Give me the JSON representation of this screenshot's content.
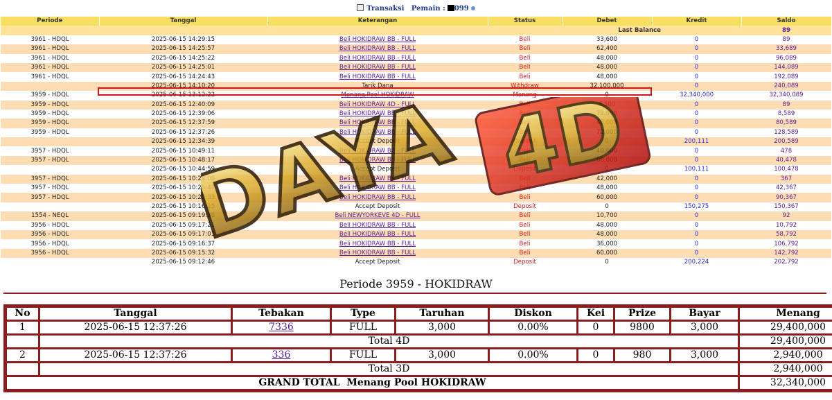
{
  "header": {
    "label": "Transaksi",
    "pemain_label": "Pemain :",
    "pemain_suffix": "099"
  },
  "transactions": {
    "columns": [
      "Periode",
      "Tanggal",
      "Keterangan",
      "Status",
      "Debet",
      "Kredit",
      "Saldo"
    ],
    "last_balance_label": "Last Balance",
    "last_balance_value": "89",
    "rows": [
      {
        "periode": "3961 - HDQL",
        "tanggal": "2025-06-15 14:29:15",
        "keterangan": "Beli HOKIDRAW BB - FULL",
        "link": true,
        "status": "Beli",
        "debet": "33,600",
        "kredit": "0",
        "saldo": "89"
      },
      {
        "periode": "3961 - HDQL",
        "tanggal": "2025-06-15 14:25:57",
        "keterangan": "Beli HOKIDRAW BB - FULL",
        "link": true,
        "status": "Beli",
        "debet": "62,400",
        "kredit": "0",
        "saldo": "33,689"
      },
      {
        "periode": "3961 - HDQL",
        "tanggal": "2025-06-15 14:25:22",
        "keterangan": "Beli HOKIDRAW BB - FULL",
        "link": true,
        "status": "Beli",
        "debet": "48,000",
        "kredit": "0",
        "saldo": "96,089"
      },
      {
        "periode": "3961 - HDQL",
        "tanggal": "2025-06-15 14:25:01",
        "keterangan": "Beli HOKIDRAW BB - FULL",
        "link": true,
        "status": "Beli",
        "debet": "48,000",
        "kredit": "0",
        "saldo": "144,089"
      },
      {
        "periode": "3961 - HDQL",
        "tanggal": "2025-06-15 14:24:43",
        "keterangan": "Beli HOKIDRAW BB - FULL",
        "link": true,
        "status": "Beli",
        "debet": "48,000",
        "kredit": "0",
        "saldo": "192,089"
      },
      {
        "periode": "",
        "tanggal": "2025-06-15 14:10:20",
        "keterangan": "Tarik Dana",
        "link": false,
        "status": "Withdraw",
        "debet": "32,100,000",
        "kredit": "0",
        "saldo": "240,089"
      },
      {
        "periode": "3959 - HDQL",
        "tanggal": "2025-06-15 13:12:22",
        "keterangan": "Menang Pool HOKIDRAW",
        "link": true,
        "status": "Menang",
        "debet": "0",
        "kredit": "32,340,000",
        "saldo": "32,340,089"
      },
      {
        "periode": "3959 - HDQL",
        "tanggal": "2025-06-15 12:40:09",
        "keterangan": "Beli HOKIDRAW 4D - FULL",
        "link": true,
        "status": "Beli",
        "debet": "8,500",
        "kredit": "0",
        "saldo": "89"
      },
      {
        "periode": "3959 - HDQL",
        "tanggal": "2025-06-15 12:39:06",
        "keterangan": "Beli HOKIDRAW BB - FULL",
        "link": true,
        "status": "Beli",
        "debet": "72,000",
        "kredit": "0",
        "saldo": "8,589"
      },
      {
        "periode": "3959 - HDQL",
        "tanggal": "2025-06-15 12:37:59",
        "keterangan": "Beli HOKIDRAW BB - FULL",
        "link": true,
        "status": "Beli",
        "debet": "48,000",
        "kredit": "0",
        "saldo": "80,589"
      },
      {
        "periode": "3959 - HDQL",
        "tanggal": "2025-06-15 12:37:26",
        "keterangan": "Beli HOKIDRAW BB - FULL",
        "link": true,
        "status": "Beli",
        "debet": "72,000",
        "kredit": "0",
        "saldo": "128,589"
      },
      {
        "periode": "",
        "tanggal": "2025-06-15 12:34:39",
        "keterangan": "Accept Deposit",
        "link": false,
        "status": "Deposit",
        "debet": "0",
        "kredit": "200,111",
        "saldo": "200,589"
      },
      {
        "periode": "3957 - HDQL",
        "tanggal": "2025-06-15 10:49:11",
        "keterangan": "Beli HOKIDRAW BB - FULL",
        "link": true,
        "status": "Beli",
        "debet": "40,000",
        "kredit": "0",
        "saldo": "478"
      },
      {
        "periode": "3957 - HDQL",
        "tanggal": "2025-06-15 10:48:17",
        "keterangan": "Beli HOKIDRAW BB - FULL",
        "link": true,
        "status": "Beli",
        "debet": "60,000",
        "kredit": "0",
        "saldo": "40,478"
      },
      {
        "periode": "",
        "tanggal": "2025-06-15 10:44:59",
        "keterangan": "Accept Deposit",
        "link": false,
        "status": "Deposit",
        "debet": "0",
        "kredit": "100,111",
        "saldo": "100,478"
      },
      {
        "periode": "3957 - HDQL",
        "tanggal": "2025-06-15 10:26:08",
        "keterangan": "Beli HOKIDRAW BB - FULL",
        "link": true,
        "status": "Beli",
        "debet": "42,000",
        "kredit": "0",
        "saldo": "367"
      },
      {
        "periode": "3957 - HDQL",
        "tanggal": "2025-06-15 10:25:47",
        "keterangan": "Beli HOKIDRAW BB - FULL",
        "link": true,
        "status": "Beli",
        "debet": "48,000",
        "kredit": "0",
        "saldo": "42,367"
      },
      {
        "periode": "3957 - HDQL",
        "tanggal": "2025-06-15 10:25:33",
        "keterangan": "Beli HOKIDRAW BB - FULL",
        "link": true,
        "status": "Beli",
        "debet": "60,000",
        "kredit": "0",
        "saldo": "90,367"
      },
      {
        "periode": "",
        "tanggal": "2025-06-15 10:16:15",
        "keterangan": "Accept Deposit",
        "link": false,
        "status": "Deposit",
        "debet": "0",
        "kredit": "150,275",
        "saldo": "150,367"
      },
      {
        "periode": "1554 - NEQL",
        "tanggal": "2025-06-15 09:19:38",
        "keterangan": "Beli NEWYORKEVE 4D - FULL",
        "link": true,
        "status": "Beli",
        "debet": "10,700",
        "kredit": "0",
        "saldo": "92"
      },
      {
        "periode": "3956 - HDQL",
        "tanggal": "2025-06-15 09:17:21",
        "keterangan": "Beli HOKIDRAW BB - FULL",
        "link": true,
        "status": "Beli",
        "debet": "48,000",
        "kredit": "0",
        "saldo": "10,792"
      },
      {
        "periode": "3956 - HDQL",
        "tanggal": "2025-06-15 09:17:01",
        "keterangan": "Beli HOKIDRAW BB - FULL",
        "link": true,
        "status": "Beli",
        "debet": "48,000",
        "kredit": "0",
        "saldo": "58,792"
      },
      {
        "periode": "3956 - HDQL",
        "tanggal": "2025-06-15 09:16:37",
        "keterangan": "Beli HOKIDRAW BB - FULL",
        "link": true,
        "status": "Beli",
        "debet": "36,000",
        "kredit": "0",
        "saldo": "106,792"
      },
      {
        "periode": "3956 - HDQL",
        "tanggal": "2025-06-15 09:15:32",
        "keterangan": "Beli HOKIDRAW BB - FULL",
        "link": true,
        "status": "Beli",
        "debet": "60,000",
        "kredit": "0",
        "saldo": "142,792"
      },
      {
        "periode": "",
        "tanggal": "2025-06-15 09:12:46",
        "keterangan": "Accept Deposit",
        "link": false,
        "status": "Deposit",
        "debet": "0",
        "kredit": "200,224",
        "saldo": "202,792"
      }
    ]
  },
  "watermark": {
    "text_left": "DAYA",
    "text_right": "4D"
  },
  "periode_detail": {
    "title": "Periode 3959 - HOKIDRAW",
    "columns": [
      "No",
      "Tanggal",
      "Tebakan",
      "Type",
      "Taruhan",
      "Diskon",
      "Kei",
      "Prize",
      "Bayar",
      "Menang"
    ],
    "bets": [
      {
        "no": "1",
        "tanggal": "2025-06-15 12:37:26",
        "tebakan": "7336",
        "type": "FULL",
        "taruhan": "3,000",
        "diskon": "0.00%",
        "kei": "0",
        "prize": "9800",
        "bayar": "3,000",
        "menang": "29,400,000",
        "total_label": "Total 4D",
        "total_value": "29,400,000"
      },
      {
        "no": "2",
        "tanggal": "2025-06-15 12:37:26",
        "tebakan": "336",
        "type": "FULL",
        "taruhan": "3,000",
        "diskon": "0.00%",
        "kei": "0",
        "prize": "980",
        "bayar": "3,000",
        "menang": "2,940,000",
        "total_label": "Total 3D",
        "total_value": "2,940,000"
      }
    ],
    "grand_total_label": "GRAND TOTAL  Menang Pool HOKIDRAW",
    "grand_total_value": "32,340,000"
  }
}
